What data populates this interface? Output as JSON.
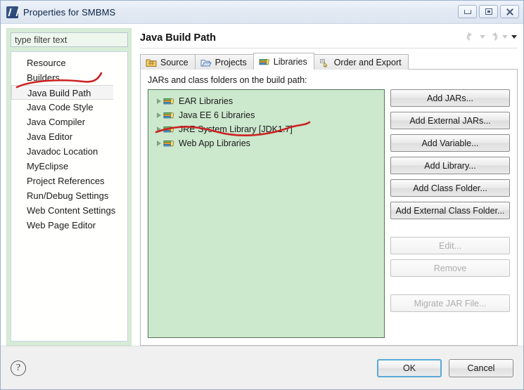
{
  "window": {
    "title": "Properties for SMBMS",
    "icon": "eclipse-app-icon",
    "controls": [
      {
        "name": "minimize-button",
        "glyph": "minimize-icon"
      },
      {
        "name": "maximize-button",
        "glyph": "maximize-icon"
      },
      {
        "name": "close-button",
        "glyph": "close-icon"
      }
    ]
  },
  "sidebar": {
    "filter": {
      "placeholder": "type filter text",
      "value": ""
    },
    "items": [
      {
        "label": "Resource",
        "selected": false
      },
      {
        "label": "Builders",
        "selected": false
      },
      {
        "label": "Java Build Path",
        "selected": true
      },
      {
        "label": "Java Code Style",
        "selected": false
      },
      {
        "label": "Java Compiler",
        "selected": false
      },
      {
        "label": "Java Editor",
        "selected": false
      },
      {
        "label": "Javadoc Location",
        "selected": false
      },
      {
        "label": "MyEclipse",
        "selected": false
      },
      {
        "label": "Project References",
        "selected": false
      },
      {
        "label": "Run/Debug Settings",
        "selected": false
      },
      {
        "label": "Web Content Settings",
        "selected": false
      },
      {
        "label": "Web Page Editor",
        "selected": false
      }
    ]
  },
  "page": {
    "title": "Java Build Path",
    "nav": {
      "back": "back-arrow-icon",
      "back_menu": "chevron-down-icon",
      "forward": "forward-arrow-icon",
      "forward_menu": "chevron-down-icon",
      "view_menu": "chevron-down-icon"
    }
  },
  "tabs": [
    {
      "label": "Source",
      "icon": "source-folder-icon",
      "active": false
    },
    {
      "label": "Projects",
      "icon": "projects-folder-icon",
      "active": false
    },
    {
      "label": "Libraries",
      "icon": "libraries-books-icon",
      "active": true
    },
    {
      "label": "Order and Export",
      "icon": "order-export-icon",
      "active": false
    }
  ],
  "libraries_panel": {
    "label": "JARs and class folders on the build path:",
    "tree": [
      {
        "label": "EAR Libraries",
        "icon": "library-books-icon",
        "expandable": true
      },
      {
        "label": "Java EE 6 Libraries",
        "icon": "library-books-icon",
        "expandable": true
      },
      {
        "label": "JRE System Library [JDK1.7]",
        "icon": "library-books-icon",
        "expandable": true
      },
      {
        "label": "Web App Libraries",
        "icon": "library-books-icon",
        "expandable": true
      }
    ],
    "buttons": [
      {
        "label": "Add JARs...",
        "enabled": true
      },
      {
        "label": "Add External JARs...",
        "enabled": true
      },
      {
        "label": "Add Variable...",
        "enabled": true
      },
      {
        "label": "Add Library...",
        "enabled": true
      },
      {
        "label": "Add Class Folder...",
        "enabled": true
      },
      {
        "label": "Add External Class Folder...",
        "enabled": true
      }
    ],
    "buttons_secondary": [
      {
        "label": "Edit...",
        "enabled": false
      },
      {
        "label": "Remove",
        "enabled": false
      }
    ],
    "buttons_tertiary": [
      {
        "label": "Migrate JAR File...",
        "enabled": false
      }
    ]
  },
  "footer": {
    "help": "?",
    "ok_label": "OK",
    "cancel_label": "Cancel"
  },
  "annotations": {
    "color": "#cc2222",
    "marks": [
      "underline-java-build-path",
      "underline-jre-system-library"
    ]
  },
  "colors": {
    "tree_background": "#cce8cd",
    "sidebar_background": "#d6ecd7",
    "accent_focus": "#5aa9d6",
    "annotation_red": "#cc2222"
  }
}
